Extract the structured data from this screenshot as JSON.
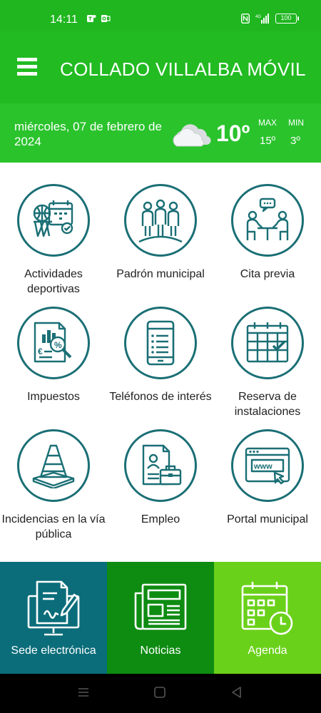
{
  "status_bar": {
    "time": "14:11",
    "battery": "100"
  },
  "header": {
    "title": "COLLADO VILLALBA MÓVIL"
  },
  "weather": {
    "date": "miércoles, 07 de febrero de 2024",
    "temperature": "10º",
    "max_label": "MAX",
    "min_label": "MIN",
    "max_value": "15º",
    "min_value": "3º",
    "icon": "cloud-icon"
  },
  "grid": {
    "items": [
      {
        "label": "Actividades deportivas",
        "icon": "sports-calendar-icon"
      },
      {
        "label": "Padrón municipal",
        "icon": "people-icon"
      },
      {
        "label": "Cita previa",
        "icon": "meeting-icon"
      },
      {
        "label": "Impuestos",
        "icon": "tax-document-icon"
      },
      {
        "label": "Teléfonos de interés",
        "icon": "phone-icon"
      },
      {
        "label": "Reserva de instalaciones",
        "icon": "calendar-check-icon"
      },
      {
        "label": "Incidencias en la vía pública",
        "icon": "traffic-cone-icon"
      },
      {
        "label": "Empleo",
        "icon": "employment-icon"
      },
      {
        "label": "Portal municipal",
        "icon": "web-browser-icon"
      }
    ]
  },
  "bottom": {
    "items": [
      {
        "label": "Sede electrónica",
        "icon": "e-signature-icon",
        "color": "#0b6d7a"
      },
      {
        "label": "Noticias",
        "icon": "newspaper-icon",
        "color": "#0e8c12"
      },
      {
        "label": "Agenda",
        "icon": "agenda-icon",
        "color": "#6ad11a"
      }
    ]
  },
  "colors": {
    "status_bar": "#1fb620",
    "app_bar": "#22bb22",
    "weather_bar": "#2ac32c",
    "icon_stroke": "#1a6f75"
  }
}
